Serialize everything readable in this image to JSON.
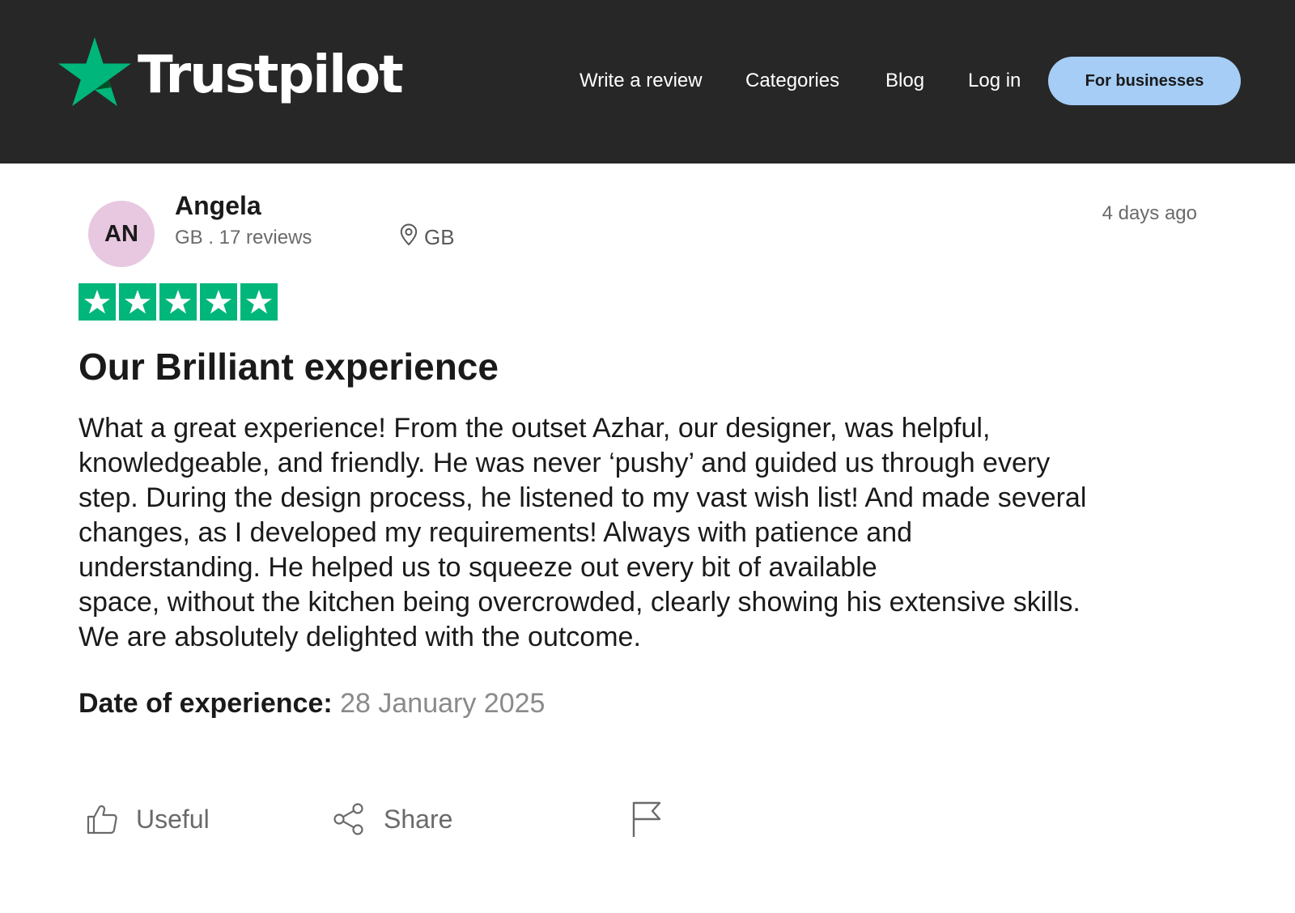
{
  "header": {
    "logo_text": "Trustpilot",
    "nav": {
      "write_review": "Write a review",
      "categories": "Categories",
      "blog": "Blog",
      "login": "Log in",
      "for_businesses": "For businesses"
    }
  },
  "review": {
    "avatar_initials": "AN",
    "reviewer_name": "Angela",
    "reviewer_meta": "GB . 17 reviews",
    "location": "GB",
    "posted": "4 days ago",
    "rating": 5,
    "title": "Our Brilliant experience",
    "body": "What a great experience! From the outset Azhar, our designer, was helpful,\nknowledgeable, and friendly. He was never ‘pushy’ and guided us through every\nstep. During the design process, he listened to my vast wish list! And made several\nchanges, as I developed my requirements! Always with patience and\nunderstanding. He helped us to squeeze out every bit of available\nspace, without the kitchen being overcrowded, clearly showing his extensive skills.\nWe are absolutely delighted with the outcome.",
    "experience_label": "Date of experience:",
    "experience_date": "28 January 2025"
  },
  "actions": {
    "useful": "Useful",
    "share": "Share"
  },
  "colors": {
    "header_bg": "#272727",
    "star_green": "#00b67a",
    "business_button": "#a5cdf5",
    "avatar_bg": "#e8c8e0"
  },
  "icons": {
    "logo": "trustpilot-star-icon",
    "location": "location-pin-icon",
    "useful": "thumbs-up-icon",
    "share": "share-icon",
    "report": "flag-icon"
  }
}
